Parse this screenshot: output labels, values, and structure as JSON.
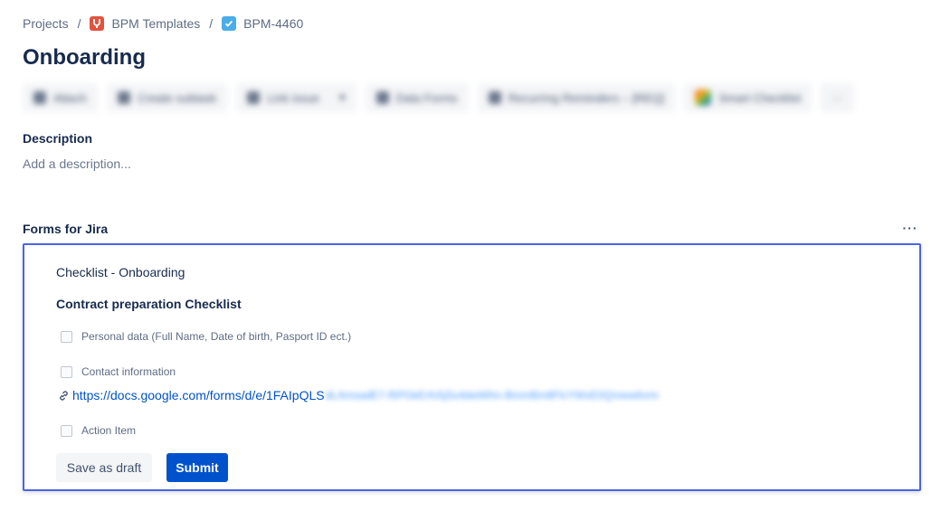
{
  "breadcrumb": {
    "projects": "Projects",
    "separator": "/",
    "project": "BPM Templates",
    "issue_key": "BPM-4460"
  },
  "page": {
    "title": "Onboarding"
  },
  "toolbar": {
    "items": [
      {
        "label": "Attach"
      },
      {
        "label": "Create subtask"
      },
      {
        "label": "Link issue"
      },
      {
        "label": "Data Forms"
      },
      {
        "label": "Recurring Reminders – [REQ]"
      },
      {
        "label": "Smart Checklist"
      }
    ],
    "more_label": "···"
  },
  "description": {
    "heading": "Description",
    "placeholder": "Add a description..."
  },
  "forms": {
    "header": "Forms for Jira",
    "more_label": "···",
    "form_title": "Checklist - Onboarding",
    "section_title": "Contract preparation Checklist",
    "items": [
      {
        "label": "Personal data (Full Name, Date of birth, Pasport ID ect.)",
        "checked": false
      },
      {
        "label": "Contact information",
        "checked": false
      },
      {
        "label": "Action Item",
        "checked": false
      }
    ],
    "link": {
      "visible_text": "https://docs.google.com/forms/d/e/1FAIpQLS",
      "blurred_text": "dLAmsadE7-f5PGkErfv5jSx4deiWhn-BmmBm8FlcYWxE0Q/viewform"
    },
    "save_draft_label": "Save as draft",
    "submit_label": "Submit"
  },
  "colors": {
    "accent": "#0052cc",
    "panel_border": "#4c63e6",
    "text_primary": "#172b4d",
    "text_secondary": "#5e6c84",
    "project_icon": "#e0533e",
    "issue_icon": "#4bade8"
  }
}
